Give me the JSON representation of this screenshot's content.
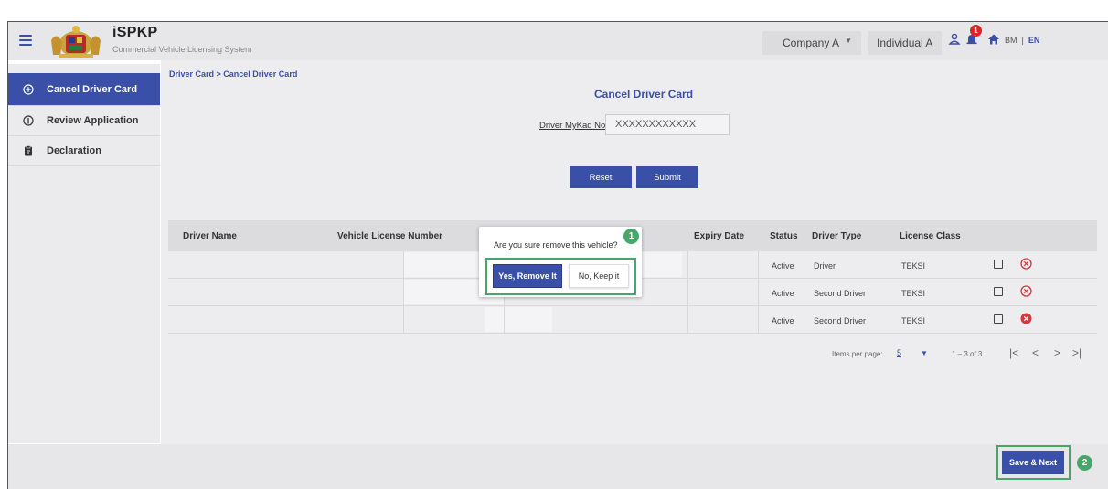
{
  "header": {
    "brand_title": "iSPKP",
    "brand_subtitle": "Commercial Vehicle Licensing System",
    "company_select": "Company A",
    "individual_select": "Individual A",
    "notification_count": "1",
    "lang_bm": "BM",
    "lang_sep": "|",
    "lang_en": "EN"
  },
  "sidebar": {
    "items": [
      {
        "label": "Cancel Driver Card",
        "icon": "plus-circle-icon",
        "active": true
      },
      {
        "label": "Review Application",
        "icon": "info-circle-icon",
        "active": false
      },
      {
        "label": "Declaration",
        "icon": "clipboard-icon",
        "active": false
      }
    ]
  },
  "main": {
    "breadcrumb": "Driver Card > Cancel Driver Card",
    "form_title": "Cancel Driver Card",
    "mykad_label": "Driver MyKad No:",
    "mykad_value": "XXXXXXXXXXXX",
    "reset_label": "Reset",
    "submit_label": "Submit"
  },
  "table": {
    "headers": {
      "driver_name": "Driver Name",
      "vehicle_license": "Vehicle License Number",
      "expiry_date": "Expiry Date",
      "status": "Status",
      "driver_type": "Driver Type",
      "license_class": "License Class"
    },
    "rows": [
      {
        "status": "Active",
        "driver_type": "Driver",
        "license_class": "TEKSI"
      },
      {
        "status": "Active",
        "driver_type": "Second Driver",
        "license_class": "TEKSI"
      },
      {
        "status": "Active",
        "driver_type": "Second Driver",
        "license_class": "TEKSI"
      }
    ]
  },
  "pager": {
    "items_per_page_label": "Items per page:",
    "page_size": "5",
    "range": "1 – 3 of 3",
    "first": "|<",
    "prev": "<",
    "next": ">",
    "last": ">|"
  },
  "modal": {
    "message": "Are you sure remove this vehicle?",
    "yes_label": "Yes, Remove It",
    "no_label": "No, Keep it",
    "step": "1"
  },
  "footer": {
    "save_label": "Save & Next",
    "step": "2"
  },
  "colors": {
    "primary": "#3a50a8",
    "highlight": "#47a76a",
    "remove": "#e0323b",
    "badge": "#d9262c"
  }
}
